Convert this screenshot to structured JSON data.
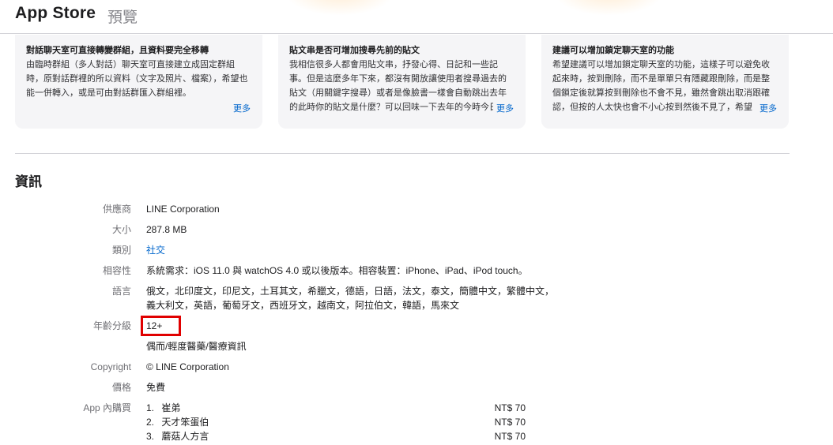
{
  "header": {
    "brand": "App Store",
    "subtitle": "預覽"
  },
  "reviews": [
    {
      "title": "對話聊天室可直接轉變群組，且資料要完全移轉",
      "body": "由臨時群組（多人對話）聊天室可直接建立成固定群組時，原對話群裡的所以資料（文字及照片、檔案），希望也能一併轉入，或是可由對話群匯入群組裡。",
      "more": "更多"
    },
    {
      "title": "貼文串是否可增加搜尋先前的貼文",
      "body": "我相信很多人都會用貼文串，抒發心得、日記和一些記事。但是這麼多年下來，都沒有開放讓使用者搜尋過去的貼文（用關鍵字搜尋）或者是像臉書一樣會自動跳出去年的此時你的貼文是什麼？可以回味一下去年的今時今日",
      "more": "更多"
    },
    {
      "title": "建議可以增加鎖定聊天室的功能",
      "body": "希望建議可以增加鎖定聊天室的功能，這樣子可以避免收起來時，按到刪除，而不是單單只有隱藏跟刪除，而是整個鎖定後就算按到刪除也不會不見，雖然會跳出取消跟確認，但按的人太快也會不小心按到然後不見了，希望",
      "more": "更多"
    }
  ],
  "info": {
    "section_title": "資訊",
    "provider_label": "供應商",
    "provider_value": "LINE Corporation",
    "size_label": "大小",
    "size_value": "287.8 MB",
    "category_label": "類別",
    "category_value": "社交",
    "compat_label": "相容性",
    "compat_value": "系統需求：iOS 11.0 與 watchOS 4.0 或以後版本。相容裝置：iPhone、iPad、iPod touch。",
    "lang_label": "語言",
    "lang_line1": "俄文，北印度文，印尼文，土耳其文，希臘文，德語，日語，法文，泰文，簡體中文，繁體中文，",
    "lang_line2": "義大利文，英語，葡萄牙文，西班牙文，越南文，阿拉伯文，韓語，馬來文",
    "age_label": "年齡分級",
    "age_value": "12+",
    "age_note": "偶而/輕度醫藥/醫療資訊",
    "copyright_label": "Copyright",
    "copyright_value": "© LINE Corporation",
    "price_label": "價格",
    "price_value": "免費",
    "iap_label": "App 內購買",
    "iap_items": [
      {
        "num": "1.",
        "name": "崔弟",
        "price": "NT$ 70"
      },
      {
        "num": "2.",
        "name": "天才笨蛋伯",
        "price": "NT$ 70"
      },
      {
        "num": "3.",
        "name": "蘑菇人方言",
        "price": "NT$ 70"
      }
    ]
  },
  "colors": {
    "link": "#0066cc",
    "highlight_box": "#e00000",
    "card_bg": "#f5f5f7"
  }
}
